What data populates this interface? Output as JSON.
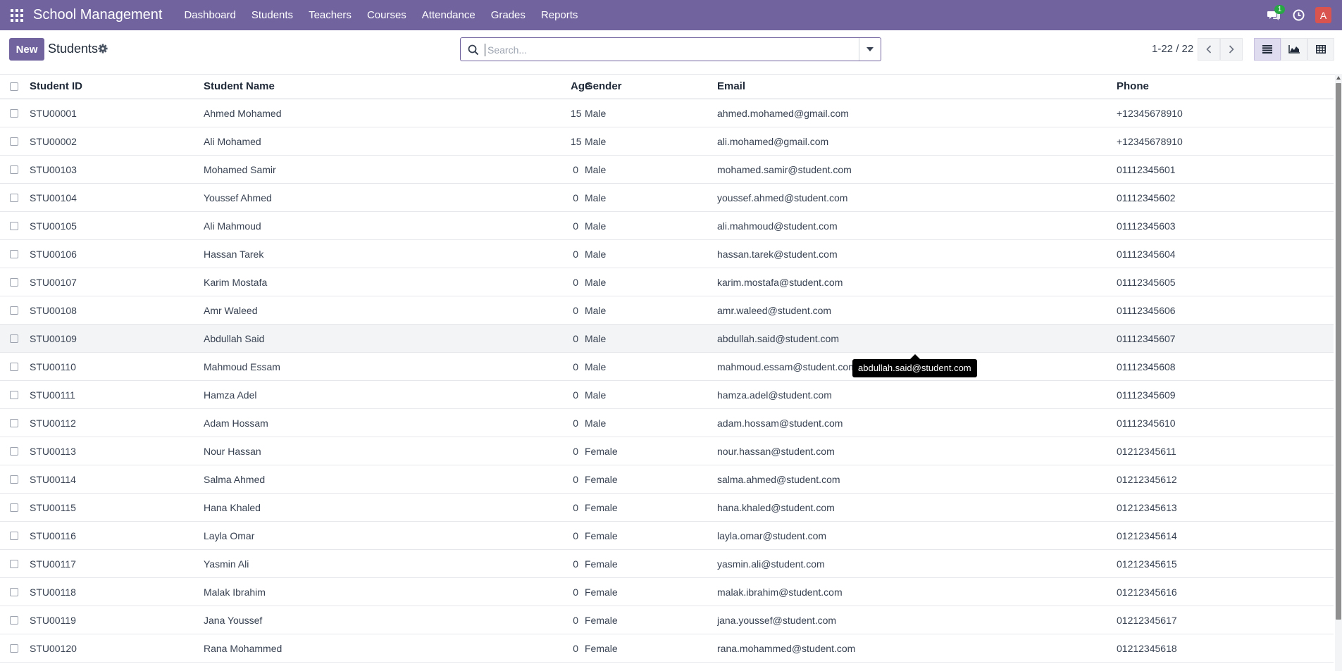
{
  "navbar": {
    "brand": "School Management",
    "menu": [
      "Dashboard",
      "Students",
      "Teachers",
      "Courses",
      "Attendance",
      "Grades",
      "Reports"
    ],
    "chat_badge": "1",
    "avatar_initial": "A"
  },
  "control": {
    "new_label": "New",
    "title": "Students",
    "search_placeholder": "Search...",
    "pager_text": "1-22 / 22"
  },
  "table": {
    "headers": {
      "student_id": "Student ID",
      "student_name": "Student Name",
      "age": "Age",
      "gender": "Gender",
      "email": "Email",
      "phone": "Phone"
    },
    "rows": [
      {
        "id": "STU00001",
        "name": "Ahmed Mohamed",
        "age": "15",
        "gender": "Male",
        "email": "ahmed.mohamed@gmail.com",
        "phone": "+12345678910"
      },
      {
        "id": "STU00002",
        "name": "Ali Mohamed",
        "age": "15",
        "gender": "Male",
        "email": "ali.mohamed@gmail.com",
        "phone": "+12345678910"
      },
      {
        "id": "STU00103",
        "name": "Mohamed Samir",
        "age": "0",
        "gender": "Male",
        "email": "mohamed.samir@student.com",
        "phone": "01112345601"
      },
      {
        "id": "STU00104",
        "name": "Youssef Ahmed",
        "age": "0",
        "gender": "Male",
        "email": "youssef.ahmed@student.com",
        "phone": "01112345602"
      },
      {
        "id": "STU00105",
        "name": "Ali Mahmoud",
        "age": "0",
        "gender": "Male",
        "email": "ali.mahmoud@student.com",
        "phone": "01112345603"
      },
      {
        "id": "STU00106",
        "name": "Hassan Tarek",
        "age": "0",
        "gender": "Male",
        "email": "hassan.tarek@student.com",
        "phone": "01112345604"
      },
      {
        "id": "STU00107",
        "name": "Karim Mostafa",
        "age": "0",
        "gender": "Male",
        "email": "karim.mostafa@student.com",
        "phone": "01112345605"
      },
      {
        "id": "STU00108",
        "name": "Amr Waleed",
        "age": "0",
        "gender": "Male",
        "email": "amr.waleed@student.com",
        "phone": "01112345606"
      },
      {
        "id": "STU00109",
        "name": "Abdullah Said",
        "age": "0",
        "gender": "Male",
        "email": "abdullah.said@student.com",
        "phone": "01112345607"
      },
      {
        "id": "STU00110",
        "name": "Mahmoud Essam",
        "age": "0",
        "gender": "Male",
        "email": "mahmoud.essam@student.com",
        "phone": "01112345608"
      },
      {
        "id": "STU00111",
        "name": "Hamza Adel",
        "age": "0",
        "gender": "Male",
        "email": "hamza.adel@student.com",
        "phone": "01112345609"
      },
      {
        "id": "STU00112",
        "name": "Adam Hossam",
        "age": "0",
        "gender": "Male",
        "email": "adam.hossam@student.com",
        "phone": "01112345610"
      },
      {
        "id": "STU00113",
        "name": "Nour Hassan",
        "age": "0",
        "gender": "Female",
        "email": "nour.hassan@student.com",
        "phone": "01212345611"
      },
      {
        "id": "STU00114",
        "name": "Salma Ahmed",
        "age": "0",
        "gender": "Female",
        "email": "salma.ahmed@student.com",
        "phone": "01212345612"
      },
      {
        "id": "STU00115",
        "name": "Hana Khaled",
        "age": "0",
        "gender": "Female",
        "email": "hana.khaled@student.com",
        "phone": "01212345613"
      },
      {
        "id": "STU00116",
        "name": "Layla Omar",
        "age": "0",
        "gender": "Female",
        "email": "layla.omar@student.com",
        "phone": "01212345614"
      },
      {
        "id": "STU00117",
        "name": "Yasmin Ali",
        "age": "0",
        "gender": "Female",
        "email": "yasmin.ali@student.com",
        "phone": "01212345615"
      },
      {
        "id": "STU00118",
        "name": "Malak Ibrahim",
        "age": "0",
        "gender": "Female",
        "email": "malak.ibrahim@student.com",
        "phone": "01212345616"
      },
      {
        "id": "STU00119",
        "name": "Jana Youssef",
        "age": "0",
        "gender": "Female",
        "email": "jana.youssef@student.com",
        "phone": "01212345617"
      },
      {
        "id": "STU00120",
        "name": "Rana Mohammed",
        "age": "0",
        "gender": "Female",
        "email": "rana.mohammed@student.com",
        "phone": "01212345618"
      }
    ],
    "hovered_row": "STU00109"
  },
  "tooltip": {
    "text": "abdullah.said@student.com"
  },
  "colors": {
    "brand": "#71639e",
    "badge": "#28a745",
    "avatar": "#d9534f"
  }
}
